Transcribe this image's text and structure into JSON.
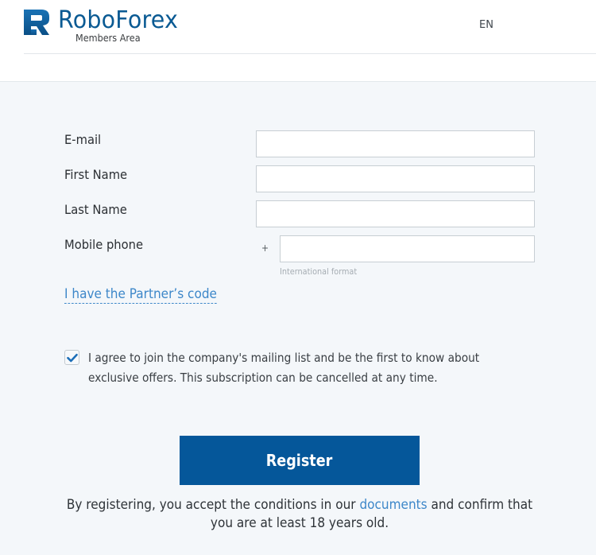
{
  "header": {
    "brand": "RoboForex",
    "subtitle": "Members Area",
    "language": "EN",
    "brand_color": "#0a5a93"
  },
  "form": {
    "fields": [
      {
        "label": "E-mail",
        "value": "",
        "placeholder": ""
      },
      {
        "label": "First Name",
        "value": "",
        "placeholder": ""
      },
      {
        "label": "Last Name",
        "value": "",
        "placeholder": ""
      },
      {
        "label": "Mobile phone",
        "prefix": "+",
        "value": "",
        "placeholder": "",
        "hint": "International format"
      }
    ],
    "partner_link": "I have the Partner’s code",
    "consent": {
      "checked": true,
      "text": "I agree to join the company's mailing list and be the first to know about exclusive offers. This subscription can be cancelled at any time."
    },
    "register_label": "Register",
    "terms": {
      "before": "By registering, you accept the conditions in our ",
      "link": "documents",
      "after": " and confirm that you are at least 18 years old."
    }
  },
  "colors": {
    "accent": "#05579a",
    "link": "#3d87c9",
    "background": "#f4f7fa"
  }
}
